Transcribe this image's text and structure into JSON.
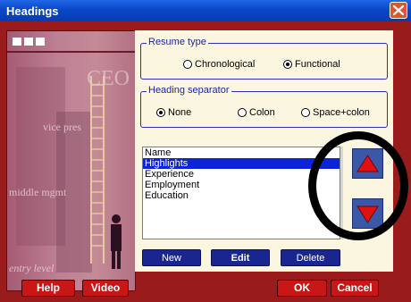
{
  "window": {
    "title": "Headings"
  },
  "left_image": {
    "words": [
      "CEO",
      "vice pres",
      "middle mgmt",
      "entry level"
    ]
  },
  "resume_type": {
    "legend": "Resume type",
    "options": [
      {
        "label": "Chronological",
        "selected": false
      },
      {
        "label": "Functional",
        "selected": true
      }
    ]
  },
  "heading_separator": {
    "legend": "Heading separator",
    "options": [
      {
        "label": "None",
        "selected": true
      },
      {
        "label": "Colon",
        "selected": false
      },
      {
        "label": "Space+colon",
        "selected": false
      }
    ]
  },
  "headings_list": {
    "items": [
      "Name",
      "Highlights",
      "Experience",
      "Employment",
      "Education"
    ],
    "selected": "Highlights"
  },
  "list_buttons": {
    "new": "New",
    "edit": "Edit",
    "delete": "Delete"
  },
  "move_buttons": {
    "up_icon": "up-arrow-icon",
    "down_icon": "down-arrow-icon"
  },
  "footer": {
    "help": "Help",
    "video": "Video",
    "ok": "OK",
    "cancel": "Cancel"
  },
  "colors": {
    "title_bar": "#0a47c9",
    "frame": "#9a1b1b",
    "panel": "#fbf6e0",
    "accent_blue": "#1a2690",
    "selection": "#0a24d6",
    "footer_button": "#c91616"
  }
}
